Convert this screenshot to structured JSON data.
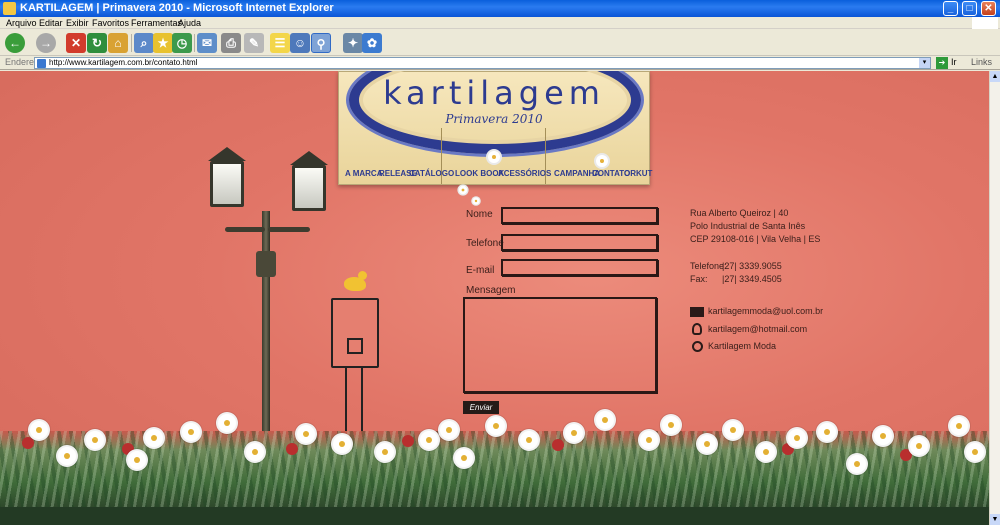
{
  "window": {
    "title": "KARTILAGEM | Primavera 2010 - Microsoft Internet Explorer",
    "controls": {
      "minimize": "_",
      "maximize": "□",
      "close": "✕"
    }
  },
  "menu": [
    "Arquivo",
    "Editar",
    "Exibir",
    "Favoritos",
    "Ferramentas",
    "Ajuda"
  ],
  "toolbar": {
    "icons": [
      "back-icon",
      "forward-icon",
      "stop-icon",
      "refresh-icon",
      "home-icon",
      "search-icon",
      "favorites-icon",
      "history-icon",
      "mail-icon",
      "print-icon",
      "edit-icon",
      "discuss-icon",
      "messenger-icon",
      "research-icon",
      "msn-icon",
      "butterfly-icon"
    ]
  },
  "address": {
    "label": "Endereço",
    "url": "http://www.kartilagem.com.br/contato.html",
    "go_label": "Ir",
    "links_label": "Links"
  },
  "site": {
    "logo": "kartilagem",
    "season": "Primavera 2010",
    "nav": [
      "A MARCA",
      "RELEASE",
      "CATÁLOGO",
      "LOOK BOOK",
      "ACESSÓRIOS",
      "CAMPANHA",
      "CONTATO",
      "ORKUT"
    ]
  },
  "form": {
    "nome_label": "Nome",
    "telefone_label": "Telefone",
    "email_label": "E-mail",
    "mensagem_label": "Mensagem",
    "send_label": "Enviar"
  },
  "contact": {
    "address_line1": "Rua Alberto Queiroz | 40",
    "address_line2": "Polo Industrial de Santa Inês",
    "address_line3": "CEP 29108-016 | Vila Velha | ES",
    "telefone_label": "Telefone:",
    "telefone_value": "|27| 3339.9055",
    "fax_label": "Fax:",
    "fax_value": "|27| 3349.4505",
    "email": "kartilagemmoda@uol.com.br",
    "msn": "kartilagem@hotmail.com",
    "orkut": "Kartilagem Moda"
  },
  "colors": {
    "background": "#e17567",
    "navy": "#2d3b90",
    "grass": "#3f6b39"
  }
}
